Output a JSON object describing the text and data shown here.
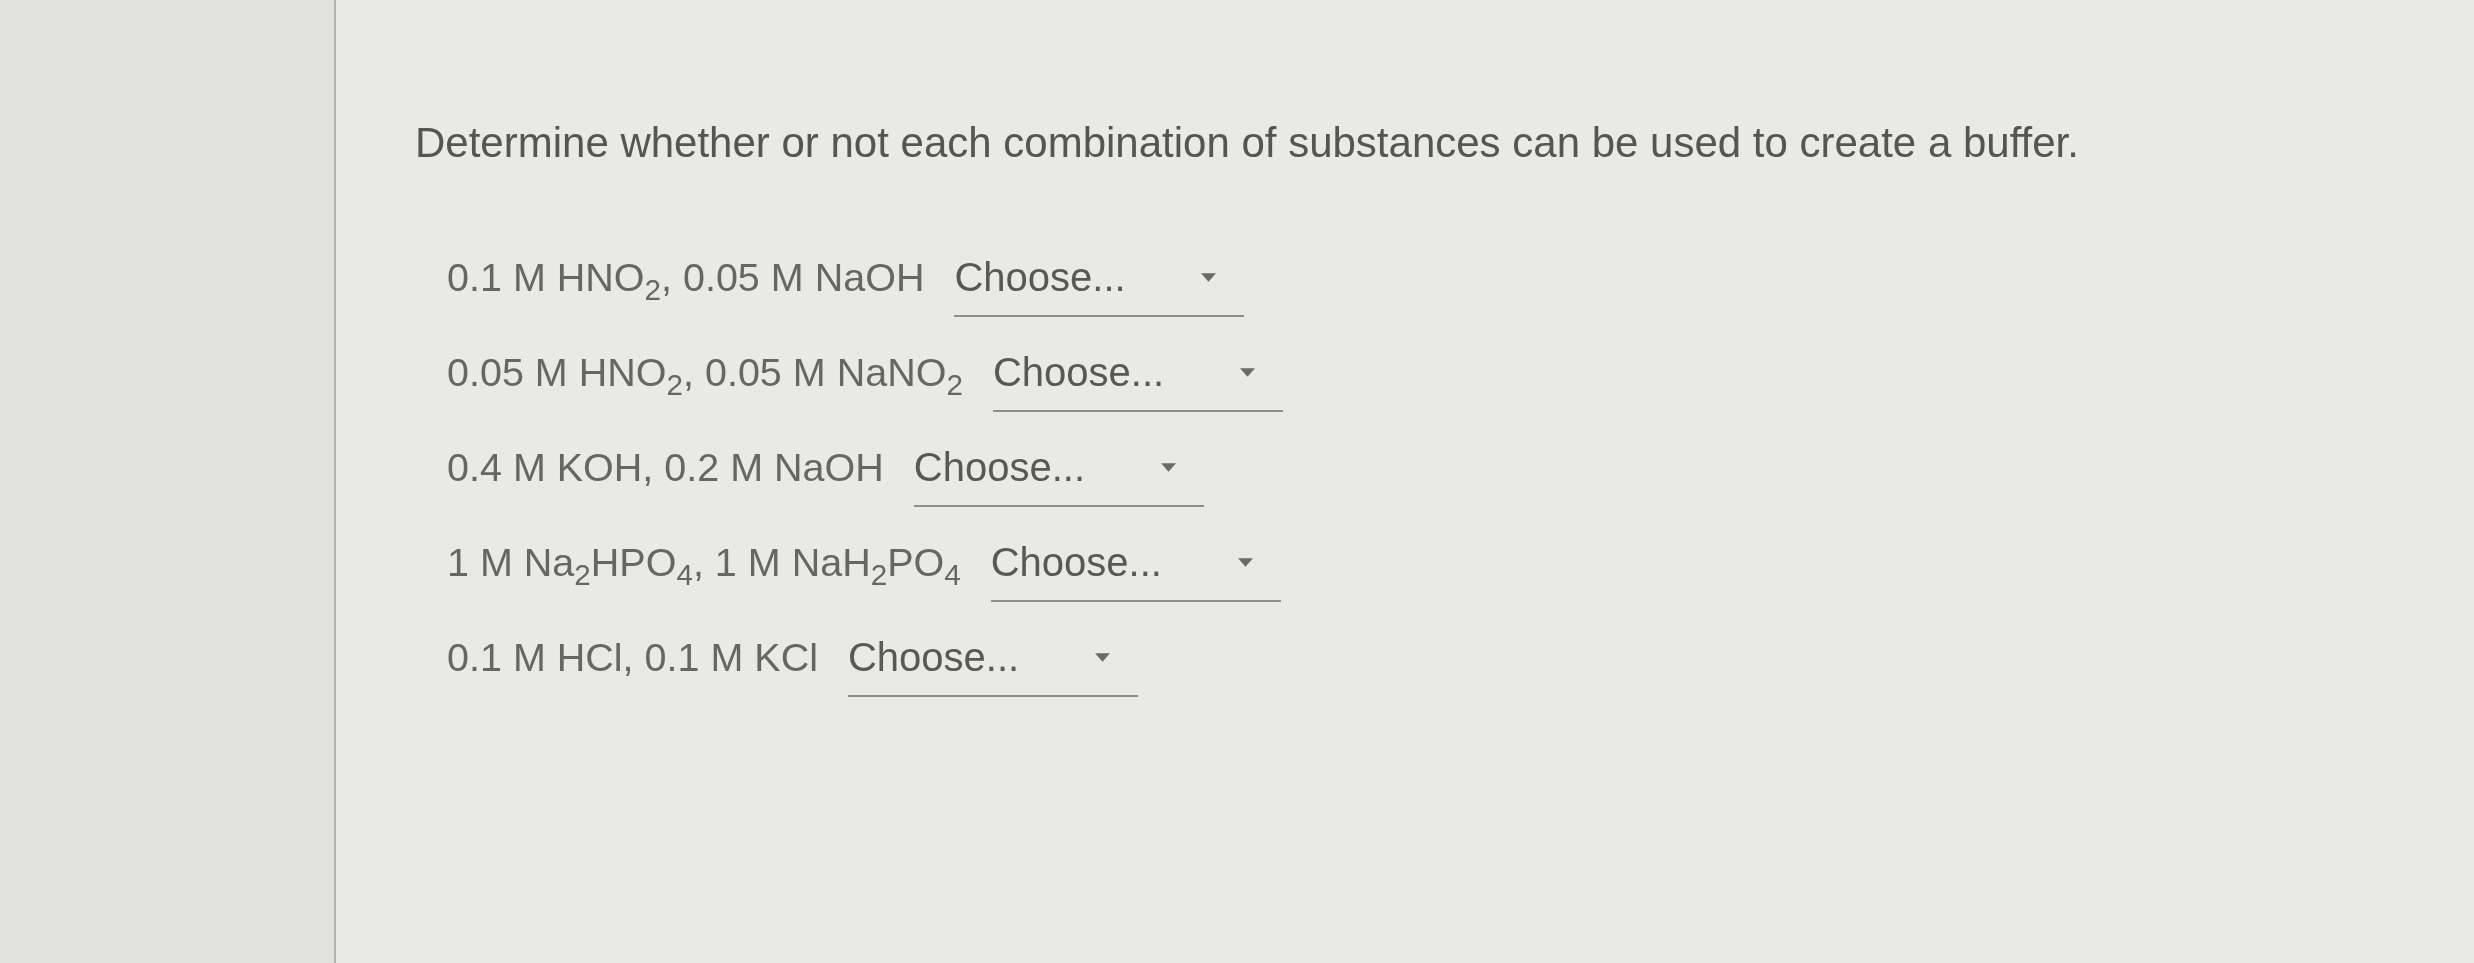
{
  "question": "Determine whether or not each combination of substances can be used to create a buffer.",
  "items": [
    {
      "label": "0.1 M HNO$_{2}$, 0.05 M NaOH",
      "dropdown": {
        "placeholder": "Choose..."
      }
    },
    {
      "label": "0.05 M HNO$_{2}$, 0.05 M NaNO$_{2}$",
      "dropdown": {
        "placeholder": "Choose..."
      }
    },
    {
      "label": "0.4 M KOH, 0.2 M NaOH",
      "dropdown": {
        "placeholder": "Choose..."
      }
    },
    {
      "label": "1 M Na$_{2}$HPO$_{4}$, 1 M NaH$_{2}$PO$_{4}$",
      "dropdown": {
        "placeholder": "Choose..."
      }
    },
    {
      "label": "0.1 M HCl, 0.1 M KCl",
      "dropdown": {
        "placeholder": "Choose..."
      }
    }
  ]
}
